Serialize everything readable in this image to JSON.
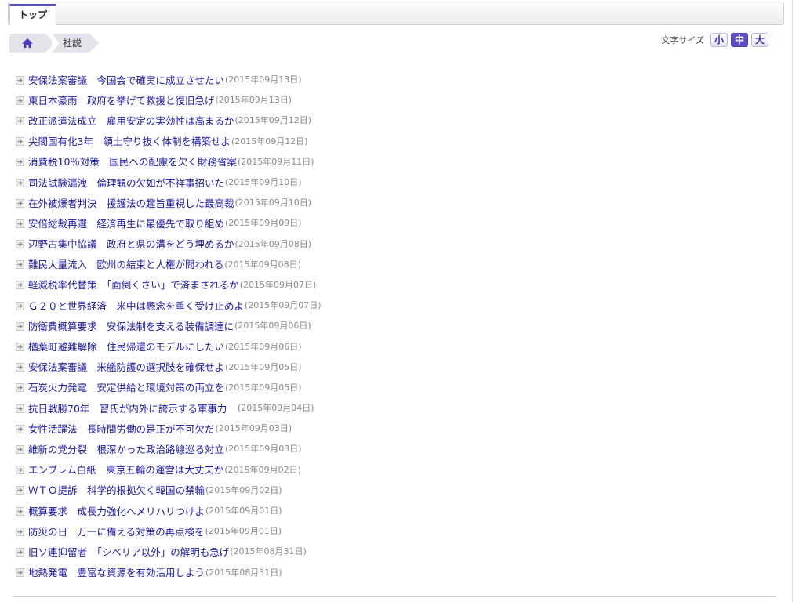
{
  "tabs": [
    {
      "label": "トップ"
    }
  ],
  "breadcrumb": {
    "home_icon": "home-icon",
    "current": "社説"
  },
  "font_size": {
    "label": "文字サイズ",
    "options": [
      "小",
      "中",
      "大"
    ],
    "selected": "中"
  },
  "colors": {
    "accent": "#5a4fc6",
    "link": "#1a1aa0",
    "date": "#888888"
  },
  "articles": [
    {
      "title": "安保法案審議　今国会で確実に成立させたい",
      "date": "(2015年09月13日)"
    },
    {
      "title": "東日本豪雨　政府を挙げて救援と復旧急げ",
      "date": "(2015年09月13日)"
    },
    {
      "title": "改正派遣法成立　雇用安定の実効性は高まるか",
      "date": "(2015年09月12日)"
    },
    {
      "title": "尖閣国有化3年　領土守り抜く体制を構築せよ",
      "date": "(2015年09月12日)"
    },
    {
      "title": "消費税10％対策　国民への配慮を欠く財務省案",
      "date": "(2015年09月11日)"
    },
    {
      "title": "司法試験漏洩　倫理観の欠如が不祥事招いた",
      "date": "(2015年09月10日)"
    },
    {
      "title": "在外被爆者判決　援護法の趣旨重視した最高裁",
      "date": "(2015年09月10日)"
    },
    {
      "title": "安倍総裁再選　経済再生に最優先で取り組め",
      "date": "(2015年09月09日)"
    },
    {
      "title": "辺野古集中協議　政府と県の溝をどう埋めるか",
      "date": "(2015年09月08日)"
    },
    {
      "title": "難民大量流入　欧州の結束と人権が問われる",
      "date": "(2015年09月08日)"
    },
    {
      "title": "軽減税率代替策　「面倒くさい」で済まされるか",
      "date": "(2015年09月07日)"
    },
    {
      "title": "Ｇ２０と世界経済　米中は懸念を重く受け止めよ",
      "date": "(2015年09月07日)"
    },
    {
      "title": "防衛費概算要求　安保法制を支える装備調達に",
      "date": "(2015年09月06日)"
    },
    {
      "title": "楢葉町避難解除　住民帰還のモデルにしたい",
      "date": "(2015年09月06日)"
    },
    {
      "title": "安保法案審議　米艦防護の選択肢を確保せよ",
      "date": "(2015年09月05日)"
    },
    {
      "title": "石炭火力発電　安定供給と環境対策の両立を",
      "date": "(2015年09月05日)"
    },
    {
      "title": "抗日戦勝70年　習氏が内外に誇示する軍事力　",
      "date": "(2015年09月04日)"
    },
    {
      "title": "女性活躍法　長時間労働の是正が不可欠だ",
      "date": "(2015年09月03日)"
    },
    {
      "title": "維新の党分裂　根深かった政治路線巡る対立",
      "date": "(2015年09月03日)"
    },
    {
      "title": "エンブレム白紙　東京五輪の運営は大丈夫か",
      "date": "(2015年09月02日)"
    },
    {
      "title": "ＷＴＯ提訴　科学的根拠欠く韓国の禁輸",
      "date": "(2015年09月02日)"
    },
    {
      "title": "概算要求　成長力強化へメリハリつけよ",
      "date": "(2015年09月01日)"
    },
    {
      "title": "防災の日　万一に備える対策の再点検を",
      "date": "(2015年09月01日)"
    },
    {
      "title": "旧ソ連抑留者　「シベリア以外」の解明も急げ",
      "date": "(2015年08月31日)"
    },
    {
      "title": "地熱発電　豊富な資源を有効活用しよう",
      "date": "(2015年08月31日)"
    }
  ]
}
